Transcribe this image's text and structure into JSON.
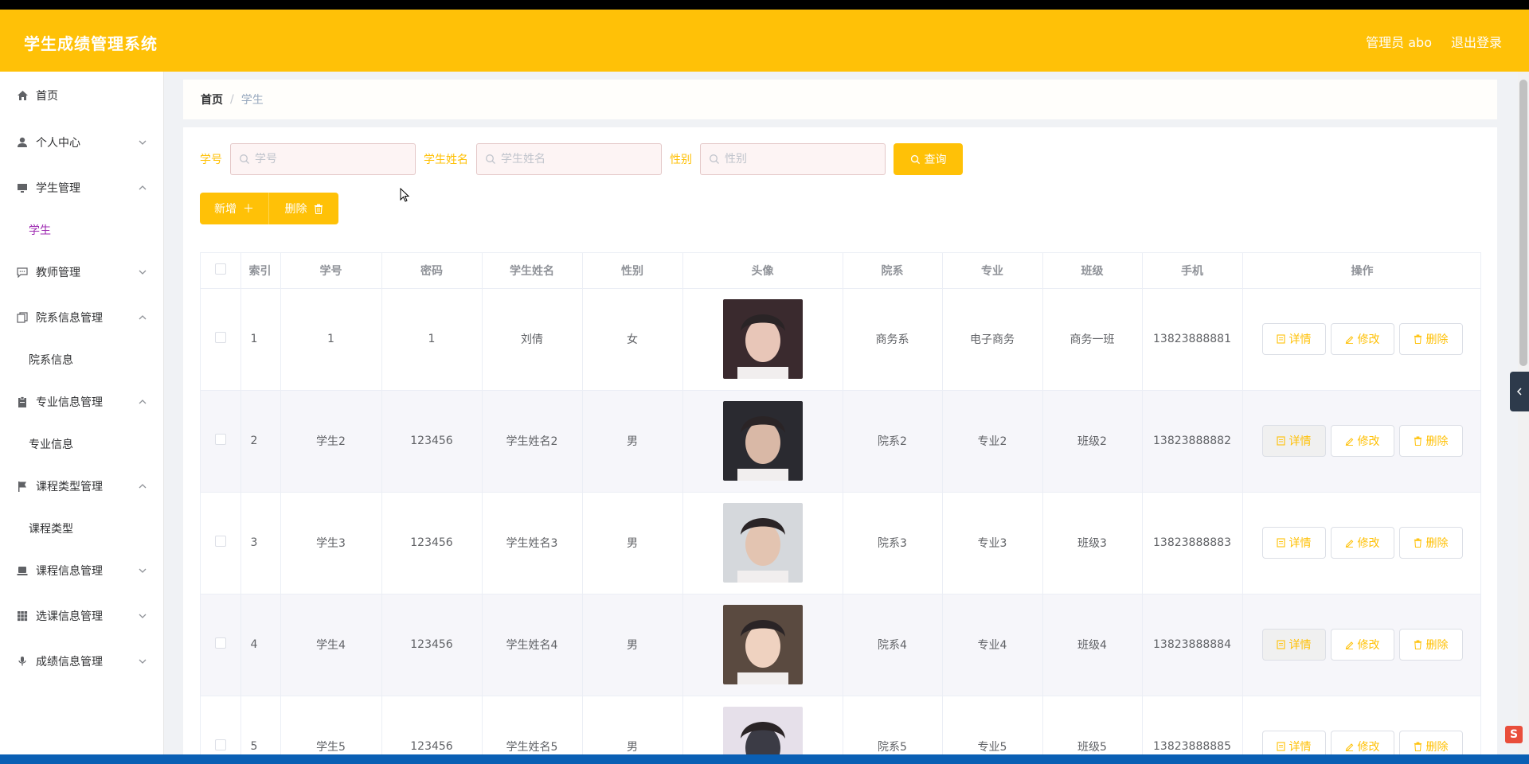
{
  "header": {
    "title": "学生成绩管理系统",
    "user_label": "管理员 abo",
    "logout_label": "退出登录"
  },
  "sidebar": {
    "items": [
      {
        "label": "首页",
        "icon": "home-icon"
      },
      {
        "label": "个人中心",
        "icon": "user-icon"
      },
      {
        "label": "学生管理",
        "icon": "monitor-icon"
      },
      {
        "label": "学生",
        "icon": ""
      },
      {
        "label": "教师管理",
        "icon": "chat-icon"
      },
      {
        "label": "院系信息管理",
        "icon": "copy-icon"
      },
      {
        "label": "院系信息",
        "icon": ""
      },
      {
        "label": "专业信息管理",
        "icon": "clipboard-icon"
      },
      {
        "label": "专业信息",
        "icon": ""
      },
      {
        "label": "课程类型管理",
        "icon": "flag-icon"
      },
      {
        "label": "课程类型",
        "icon": ""
      },
      {
        "label": "课程信息管理",
        "icon": "laptop-icon"
      },
      {
        "label": "选课信息管理",
        "icon": "grid-icon"
      },
      {
        "label": "成绩信息管理",
        "icon": "microphone-icon"
      }
    ]
  },
  "breadcrumb": {
    "home": "首页",
    "separator": "/",
    "current": "学生"
  },
  "search": {
    "student_no_label": "学号",
    "student_no_placeholder": "学号",
    "student_name_label": "学生姓名",
    "student_name_placeholder": "学生姓名",
    "gender_label": "性别",
    "gender_placeholder": "性别",
    "query_label": "查询"
  },
  "actions": {
    "add_label": "新增",
    "delete_label": "删除"
  },
  "table": {
    "columns": [
      "索引",
      "学号",
      "密码",
      "学生姓名",
      "性别",
      "头像",
      "院系",
      "专业",
      "班级",
      "手机",
      "操作"
    ],
    "rows": [
      {
        "index": "1",
        "student_no": "1",
        "password": "1",
        "name": "刘倩",
        "gender": "女",
        "department": "商务系",
        "major": "电子商务",
        "class": "商务一班",
        "phone": "13823888881"
      },
      {
        "index": "2",
        "student_no": "学生2",
        "password": "123456",
        "name": "学生姓名2",
        "gender": "男",
        "department": "院系2",
        "major": "专业2",
        "class": "班级2",
        "phone": "13823888882"
      },
      {
        "index": "3",
        "student_no": "学生3",
        "password": "123456",
        "name": "学生姓名3",
        "gender": "男",
        "department": "院系3",
        "major": "专业3",
        "class": "班级3",
        "phone": "13823888883"
      },
      {
        "index": "4",
        "student_no": "学生4",
        "password": "123456",
        "name": "学生姓名4",
        "gender": "男",
        "department": "院系4",
        "major": "专业4",
        "class": "班级4",
        "phone": "13823888884"
      },
      {
        "index": "5",
        "student_no": "学生5",
        "password": "123456",
        "name": "学生姓名5",
        "gender": "男",
        "department": "院系5",
        "major": "专业5",
        "class": "班级5",
        "phone": "13823888885"
      }
    ],
    "op_detail": "详情",
    "op_edit": "修改",
    "op_delete": "删除"
  },
  "colors": {
    "accent": "#ffc107",
    "active_menu": "#9c27b0"
  }
}
